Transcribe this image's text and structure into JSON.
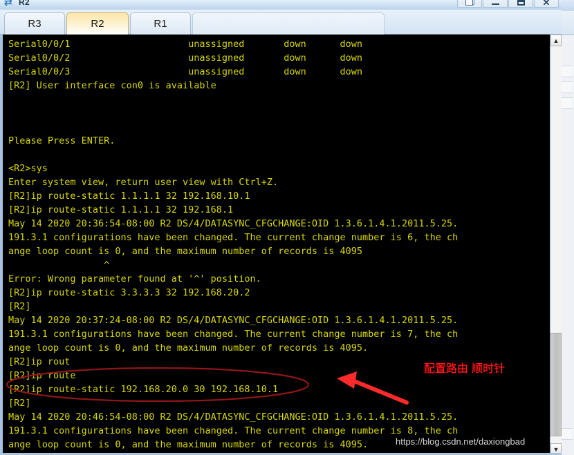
{
  "window": {
    "title": "R2",
    "icon": "router-icon",
    "controls": [
      {
        "name": "restore-button",
        "glyph": "restore-icon",
        "label": "Restore"
      },
      {
        "name": "minimize-button",
        "glyph": "minimize-icon",
        "label": "Minimize"
      },
      {
        "name": "maximize-button",
        "glyph": "maximize-icon",
        "label": "Maximize"
      },
      {
        "name": "close-button",
        "glyph": "close-icon",
        "label": "Close"
      }
    ]
  },
  "tabs": [
    {
      "label": "R3",
      "active": false
    },
    {
      "label": "R2",
      "active": true
    },
    {
      "label": "R1",
      "active": false
    }
  ],
  "terminal": {
    "foreground_color": "#d7d700",
    "background_color": "#000000",
    "lines": [
      "Serial0/0/1                     unassigned       down      down",
      "Serial0/0/2                     unassigned       down      down",
      "Serial0/0/3                     unassigned       down      down",
      "[R2] User interface con0 is available",
      "",
      "",
      "",
      "Please Press ENTER.",
      "",
      "<R2>sys",
      "Enter system view, return user view with Ctrl+Z.",
      "[R2]ip route-static 1.1.1.1 32 192.168.10.1",
      "[R2]ip route-static 1.1.1.1 32 192.168.1",
      "May 14 2020 20:36:54-08:00 R2 DS/4/DATASYNC_CFGCHANGE:OID 1.3.6.1.4.1.2011.5.25.",
      "191.3.1 configurations have been changed. The current change number is 6, the ch",
      "ange loop count is 0, and the maximum number of records is 4095",
      "                 ^",
      "Error: Wrong parameter found at '^' position.",
      "[R2]ip route-static 3.3.3.3 32 192.168.20.2",
      "[R2]",
      "May 14 2020 20:37:24-08:00 R2 DS/4/DATASYNC_CFGCHANGE:OID 1.3.6.1.4.1.2011.5.25.",
      "191.3.1 configurations have been changed. The current change number is 7, the ch",
      "ange loop count is 0, and the maximum number of records is 4095.",
      "[R2]ip rout",
      "[R2]ip route",
      "[R2]ip route-static 192.168.20.0 30 192.168.10.1",
      "[R2]",
      "May 14 2020 20:46:54-08:00 R2 DS/4/DATASYNC_CFGCHANGE:OID 1.3.6.1.4.1.2011.5.25.",
      "191.3.1 configurations have been changed. The current change number is 8, the ch",
      "ange loop count is 0, and the maximum number of records is 4095."
    ]
  },
  "scrollbar": {
    "up_arrow": "▲",
    "down_arrow": "▼",
    "thumb_name": "scrollbar-thumb"
  },
  "annotation": {
    "text": "配置路由 顺时针",
    "color": "#ff1a1a",
    "ellipse_color": "#8f1717",
    "arrow_color": "#ff2b2b"
  },
  "watermark": {
    "text": "https://blog.csdn.net/daxiongbad"
  }
}
